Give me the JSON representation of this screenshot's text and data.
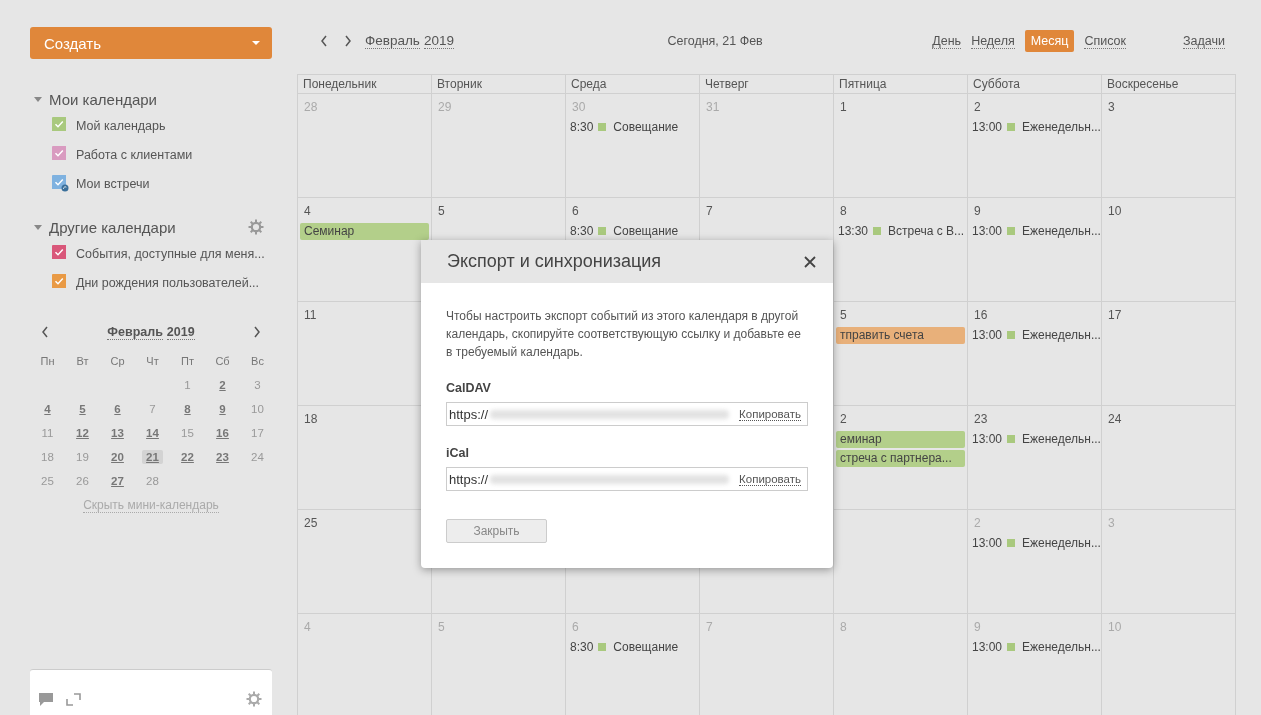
{
  "create_button": {
    "label": "Создать"
  },
  "sidebar": {
    "groups": [
      {
        "title": "Мои календари",
        "expanded": true,
        "settings": false,
        "calendars": [
          {
            "name": "Мой календарь",
            "color": "#a9c97e",
            "checked": true,
            "kind": "own"
          },
          {
            "name": "Работа с клиентами",
            "color": "#d99bc0",
            "checked": true,
            "kind": "own"
          },
          {
            "name": "Мои встречи",
            "color": "#7fb2e0",
            "checked": true,
            "kind": "shared"
          }
        ]
      },
      {
        "title": "Другие календари",
        "expanded": true,
        "settings": true,
        "calendars": [
          {
            "name": "События, доступные для меня...",
            "color": "#d9577a",
            "checked": true,
            "kind": "own"
          },
          {
            "name": "Дни рождения пользователей...",
            "color": "#e99a45",
            "checked": true,
            "kind": "own"
          }
        ]
      }
    ]
  },
  "mini_calendar": {
    "month": "Февраль",
    "year": "2019",
    "weekdays": [
      "Пн",
      "Вт",
      "Ср",
      "Чт",
      "Пт",
      "Сб",
      "Вс"
    ],
    "weeks": [
      [
        {
          "day": "1",
          "has_events": false,
          "today": false
        },
        {
          "day": "2",
          "has_events": true,
          "today": false
        },
        {
          "day": "3",
          "has_events": false,
          "today": false
        }
      ],
      [
        {
          "day": "4",
          "has_events": true,
          "today": false
        },
        {
          "day": "5",
          "has_events": true,
          "today": false
        },
        {
          "day": "6",
          "has_events": true,
          "today": false
        },
        {
          "day": "7",
          "has_events": false,
          "today": false
        },
        {
          "day": "8",
          "has_events": true,
          "today": false
        },
        {
          "day": "9",
          "has_events": true,
          "today": false
        },
        {
          "day": "10",
          "has_events": false,
          "today": false
        }
      ],
      [
        {
          "day": "11",
          "has_events": false,
          "today": false
        },
        {
          "day": "12",
          "has_events": true,
          "today": false
        },
        {
          "day": "13",
          "has_events": true,
          "today": false
        },
        {
          "day": "14",
          "has_events": true,
          "today": false
        },
        {
          "day": "15",
          "has_events": false,
          "today": false
        },
        {
          "day": "16",
          "has_events": true,
          "today": false
        },
        {
          "day": "17",
          "has_events": false,
          "today": false
        }
      ],
      [
        {
          "day": "18",
          "has_events": false,
          "today": false
        },
        {
          "day": "19",
          "has_events": false,
          "today": false
        },
        {
          "day": "20",
          "has_events": true,
          "today": false
        },
        {
          "day": "21",
          "has_events": true,
          "today": true
        },
        {
          "day": "22",
          "has_events": true,
          "today": false
        },
        {
          "day": "23",
          "has_events": true,
          "today": false
        },
        {
          "day": "24",
          "has_events": false,
          "today": false
        }
      ],
      [
        {
          "day": "25",
          "has_events": false,
          "today": false
        },
        {
          "day": "26",
          "has_events": false,
          "today": false
        },
        {
          "day": "27",
          "has_events": true,
          "today": false
        },
        {
          "day": "28",
          "has_events": false,
          "today": false
        }
      ]
    ],
    "hide_link": "Скрыть мини-календарь"
  },
  "toolbar": {
    "month": "Февраль",
    "year": "2019",
    "today": "Сегодня, 21 Фев",
    "views": [
      {
        "label": "День",
        "selected": false
      },
      {
        "label": "Неделя",
        "selected": false
      },
      {
        "label": "Месяц",
        "selected": true
      },
      {
        "label": "Список",
        "selected": false
      }
    ],
    "tasks": "Задачи"
  },
  "month_grid": {
    "weekdays": [
      "Понедельник",
      "Вторник",
      "Среда",
      "Четверг",
      "Пятница",
      "Суббота",
      "Воскресенье"
    ],
    "weeks": [
      {
        "mon": {
          "date": "28",
          "other_month": true
        },
        "tue": {
          "date": "29",
          "other_month": true
        },
        "wed": {
          "date": "30",
          "other_month": true,
          "events": [
            {
              "kind": "timed",
              "time": "8:30",
              "title": "Совещание",
              "color": "#a9c97e"
            }
          ]
        },
        "thu": {
          "date": "31",
          "other_month": true
        },
        "fri": {
          "date": "1",
          "other_month": false
        },
        "sat": {
          "date": "2",
          "other_month": false,
          "events": [
            {
              "kind": "timed",
              "time": "13:00",
              "title": "Еженедельн...",
              "color": "#a9c97e"
            }
          ]
        },
        "sun": {
          "date": "3",
          "other_month": false
        }
      },
      {
        "mon": {
          "date": "4",
          "other_month": false,
          "events": [
            {
              "kind": "bar",
              "title": "Семинар",
              "color": "#b3cf8a"
            }
          ]
        },
        "tue": {
          "date": "5",
          "other_month": false
        },
        "wed": {
          "date": "6",
          "other_month": false,
          "events": [
            {
              "kind": "timed",
              "time": "8:30",
              "title": "Совещание",
              "color": "#a9c97e"
            }
          ]
        },
        "thu": {
          "date": "7",
          "other_month": false
        },
        "fri": {
          "date": "8",
          "other_month": false,
          "events": [
            {
              "kind": "timed",
              "time": "13:30",
              "title": "Встреча с В...",
              "color": "#a9c97e"
            }
          ]
        },
        "sat": {
          "date": "9",
          "other_month": false,
          "events": [
            {
              "kind": "timed",
              "time": "13:00",
              "title": "Еженедельн...",
              "color": "#a9c97e"
            }
          ]
        },
        "sun": {
          "date": "10",
          "other_month": false
        }
      },
      {
        "mon": {
          "date": "11",
          "other_month": false
        },
        "fri": {
          "date": "5",
          "other_month": false,
          "events": [
            {
              "kind": "bar",
              "title": "тправить счета",
              "color": "#e8b07a"
            }
          ]
        },
        "sat": {
          "date": "16",
          "other_month": false,
          "events": [
            {
              "kind": "timed",
              "time": "13:00",
              "title": "Еженедельн...",
              "color": "#a9c97e"
            }
          ]
        },
        "sun": {
          "date": "17",
          "other_month": false
        }
      },
      {
        "mon": {
          "date": "18",
          "other_month": false
        },
        "fri": {
          "date": "2",
          "other_month": false,
          "events": [
            {
              "kind": "bar",
              "title": "еминар",
              "color": "#b3cf8a"
            },
            {
              "kind": "bar",
              "title": "стреча с партнера...",
              "color": "#b3cf8a"
            }
          ]
        },
        "sat": {
          "date": "23",
          "other_month": false,
          "events": [
            {
              "kind": "timed",
              "time": "13:00",
              "title": "Еженедельн...",
              "color": "#a9c97e"
            }
          ]
        },
        "sun": {
          "date": "24",
          "other_month": false
        }
      },
      {
        "mon": {
          "date": "25",
          "other_month": false
        },
        "sat": {
          "date": "2",
          "other_month": true,
          "events": [
            {
              "kind": "timed",
              "time": "13:00",
              "title": "Еженедельн...",
              "color": "#a9c97e"
            }
          ]
        },
        "sun": {
          "date": "3",
          "other_month": true
        }
      },
      {
        "mon": {
          "date": "4",
          "other_month": true
        },
        "tue": {
          "date": "5",
          "other_month": true
        },
        "wed": {
          "date": "6",
          "other_month": true,
          "events": [
            {
              "kind": "timed",
              "time": "8:30",
              "title": "Совещание",
              "color": "#a9c97e"
            }
          ]
        },
        "thu": {
          "date": "7",
          "other_month": true
        },
        "fri": {
          "date": "8",
          "other_month": true
        },
        "sat": {
          "date": "9",
          "other_month": true,
          "events": [
            {
              "kind": "timed",
              "time": "13:00",
              "title": "Еженедельн...",
              "color": "#a9c97e"
            }
          ]
        },
        "sun": {
          "date": "10",
          "other_month": true
        }
      }
    ]
  },
  "dialog": {
    "title": "Экспорт и синхронизация",
    "description": "Чтобы настроить экспорт событий из этого календаря в другой календарь, скопируйте соответствующую ссылку и добавьте ее в требуемый календарь.",
    "links": [
      {
        "label": "CalDAV",
        "value": "https://",
        "copy": "Копировать"
      },
      {
        "label": "iCal",
        "value": "https://",
        "copy": "Копировать"
      }
    ],
    "close_button": "Закрыть"
  }
}
